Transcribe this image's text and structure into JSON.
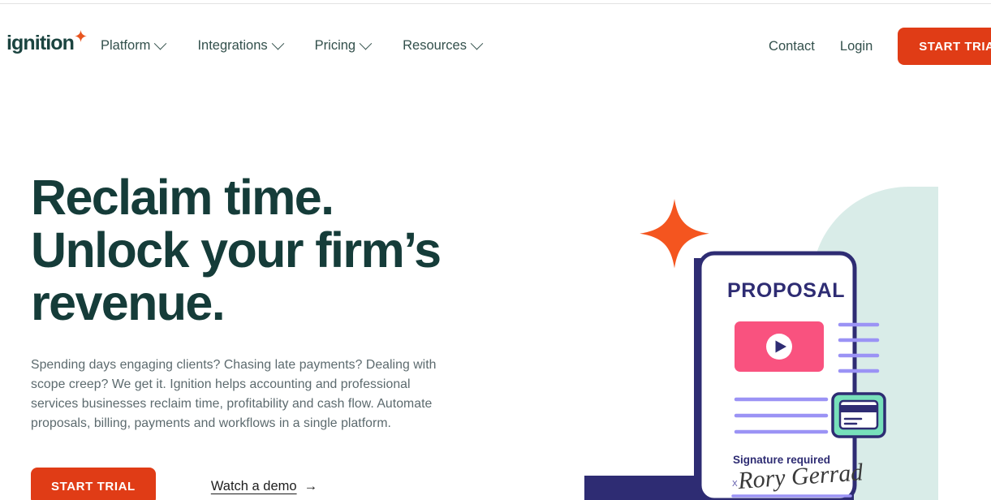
{
  "brand": {
    "logo_text": "ignition",
    "accent_orange": "#e03c16",
    "dark_green": "#153c39",
    "navy": "#2e2c73",
    "mint": "#d9ece8",
    "pink": "#f9527f",
    "periwinkle": "#9b93f5",
    "green_card": "#78e0bb"
  },
  "header": {
    "nav_items": [
      {
        "label": "Platform",
        "has_caret": true
      },
      {
        "label": "Integrations",
        "has_caret": true
      },
      {
        "label": "Pricing",
        "has_caret": true
      },
      {
        "label": "Resources",
        "has_caret": true
      }
    ],
    "contact_label": "Contact",
    "login_label": "Login",
    "start_trial_label": "START TRIAL"
  },
  "hero": {
    "title": "Reclaim time.\nUnlock your firm’s\nrevenue.",
    "paragraph": "Spending days engaging clients? Chasing late payments? Dealing with scope creep? We get it. Ignition helps accounting and professional services businesses reclaim time, profitability and cash flow. Automate proposals, billing, payments and workflows in a single platform.",
    "cta_primary_label": "START TRIAL",
    "cta_secondary_label": "Watch a demo",
    "cta_secondary_arrow": "→"
  },
  "illustration": {
    "card_title": "PROPOSAL",
    "signature_label": "Signature required",
    "signature_x": "X",
    "signature_name": "Rory Gerrad",
    "video_play_icon": "play-icon",
    "payment_icon": "credit-card-icon",
    "sparkle_icon": "four-point-star-icon",
    "text_line_count": 4,
    "body_line_count": 3
  }
}
